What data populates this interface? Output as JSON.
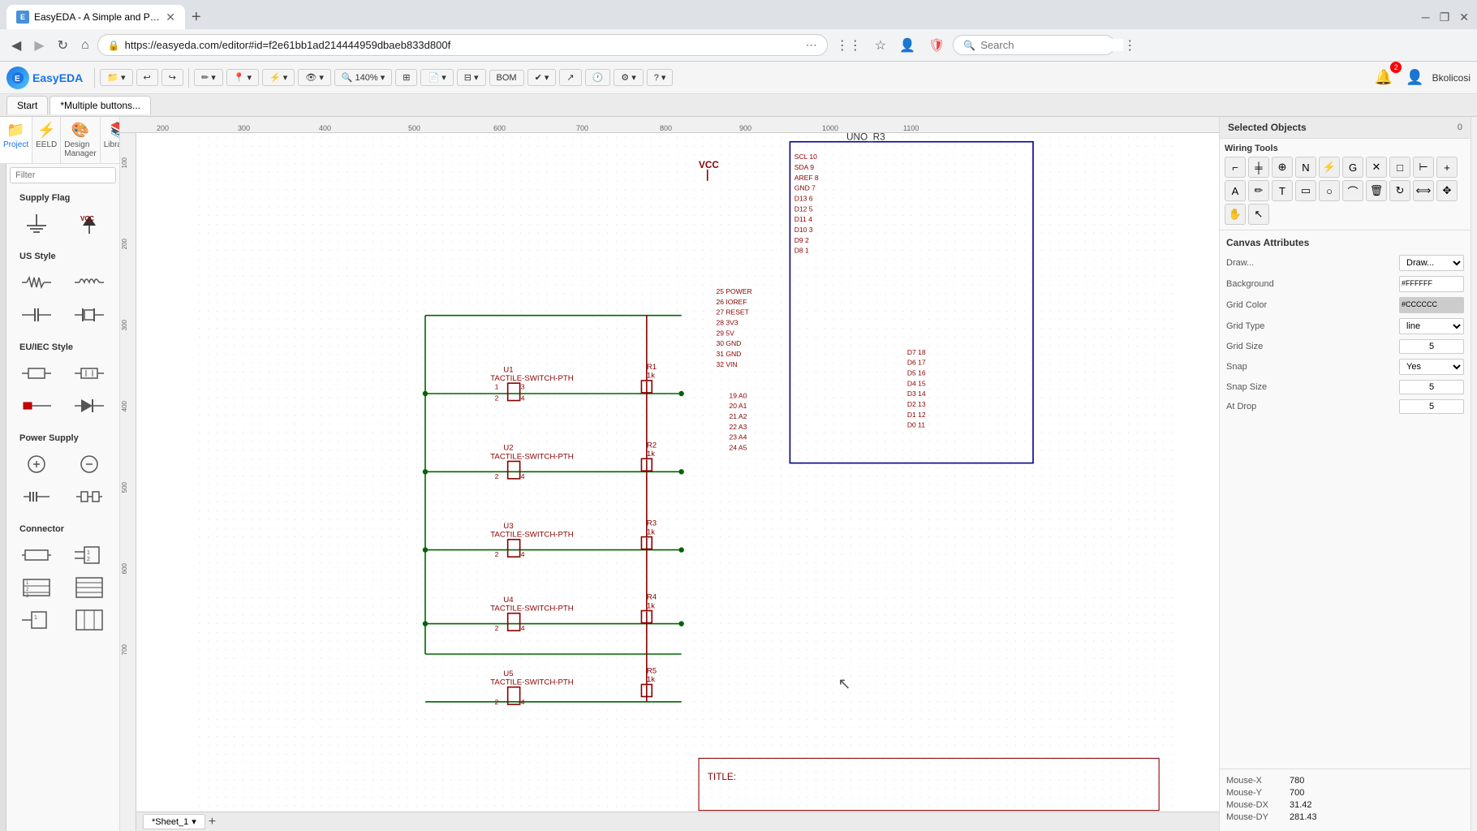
{
  "browser": {
    "tab_title": "EasyEDA - A Simple and Pow...",
    "tab_favicon": "E",
    "url": "https://easyeda.com/editor#id=f2e61bb1ad214444959dbaeb833d800f",
    "search_placeholder": "Search"
  },
  "toolbar": {
    "logo_text": "EasyEDA",
    "file_btn": "File",
    "undo_label": "↩",
    "redo_label": "↪",
    "draw_label": "Draw ▾",
    "place_label": "Place ▾",
    "route_label": "Route ▾",
    "bom_label": "BOM",
    "zoom_value": "140%",
    "view_label": "View ▾",
    "settings_label": "⚙ ▾",
    "help_label": "? ▾"
  },
  "tabs": {
    "start_label": "Start",
    "editor_label": "*Multiple buttons..."
  },
  "sidebar": {
    "filter_placeholder": "Filter",
    "supply_flag_title": "Supply Flag",
    "us_style_title": "US Style",
    "eu_iec_style_title": "EU/IEC Style",
    "power_supply_title": "Power Supply",
    "connector_title": "Connector"
  },
  "right_panel": {
    "selected_objects_label": "Selected Objects",
    "selected_objects_count": "0",
    "wiring_tools_label": "Wiring Tools",
    "canvas_attrs_label": "Canvas Attributes",
    "draw_label": "Draw...",
    "bg_color": "#FFFFFF",
    "grid_color": "#CCCCCC",
    "grid_type": "line",
    "grid_size": "5",
    "snap_yes": "Yes",
    "snap_size": "5",
    "at_drop": "5",
    "mouse_x_label": "Mouse-X",
    "mouse_x_value": "780",
    "mouse_y_label": "Mouse-Y",
    "mouse_y_value": "700",
    "mouse_dx_label": "Mouse-DX",
    "mouse_dx_value": "31.42",
    "mouse_dy_label": "Mouse-DY",
    "mouse_dy_value": "281.43"
  },
  "schematic": {
    "vcc_label": "VCC",
    "component_u1": "U1\nTACTILE-SWITCH-PTH",
    "component_u2": "U2\nTACTILE-SWITCH-PTH",
    "component_u3": "U3\nTACTILE-SWITCH-PTH",
    "component_u4": "U4\nTACTILE-SWITCH-PTH",
    "component_u5": "U5\nTACTILE-SWITCH-PTH",
    "resistor_r1": "R1\n1k",
    "resistor_r2": "R2\n1k",
    "resistor_r3": "R3\n1k",
    "resistor_r4": "R4\n1k",
    "resistor_r5": "R5\n1k",
    "uno_label": "UNO_R3",
    "title_block": "TITLE:"
  },
  "sheet": {
    "tab_label": "*Sheet_1",
    "add_label": "+"
  },
  "ruler": {
    "ticks_h": [
      "200",
      "300",
      "400",
      "500",
      "600",
      "700",
      "800",
      "900",
      "1000",
      "1100"
    ],
    "ticks_v": [
      "100",
      "200",
      "300",
      "400",
      "500",
      "600",
      "700"
    ]
  }
}
